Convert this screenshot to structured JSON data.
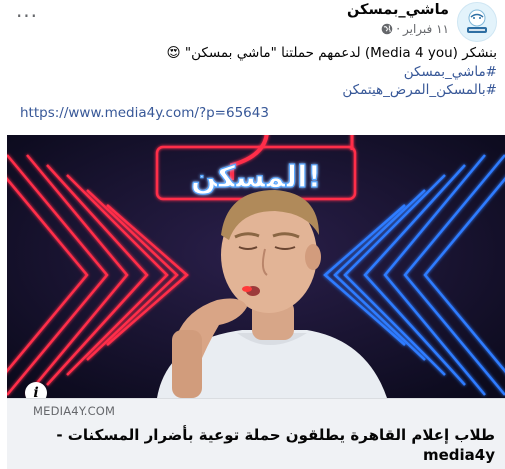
{
  "post": {
    "page_name": "ماشي_بمسكن",
    "date": "١١ فبراير",
    "separator": "·",
    "more_label": "···",
    "text_line1": "بنشكر (Media 4 you) لدعمهم حملتنا \"ماشي بمسكن\"",
    "emoji": "😍",
    "hashtag1": "#ماشي_بمسكن",
    "hashtag2": "#بالمسكن_المرض_هيتمكن",
    "link": "https://www.media4y.com/?p=65643"
  },
  "image": {
    "overlay_text": "المسكن!",
    "info_label": "i"
  },
  "preview": {
    "domain": "MEDIA4Y.COM",
    "headline": "طلاب إعلام القاهرة يطلقون حملة توعية بأضرار المسكنات - media4y"
  },
  "colors": {
    "link": "#385898",
    "muted": "#65676b",
    "neon_red": "#ff2d4a",
    "neon_blue": "#2f7bff",
    "preview_bg": "#f0f2f5"
  },
  "icons": {
    "globe": "globe-icon",
    "more": "more-options-icon",
    "info": "info-icon",
    "avatar": "page-avatar"
  }
}
